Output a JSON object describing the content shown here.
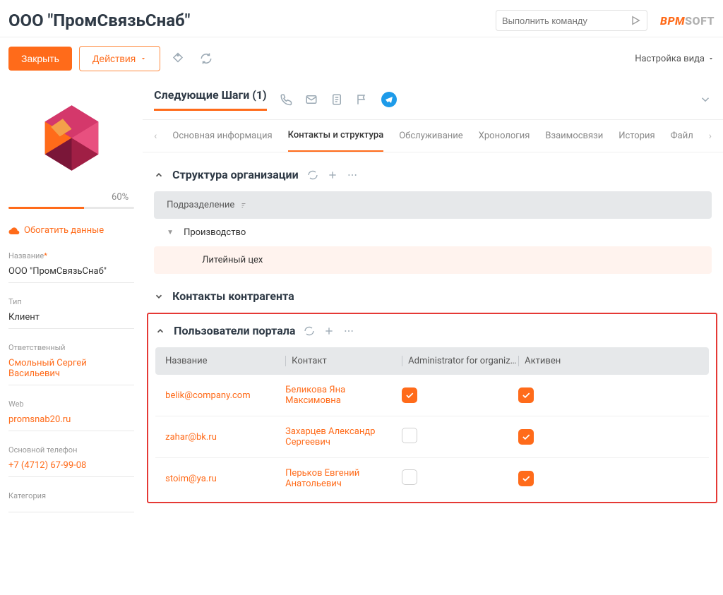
{
  "header": {
    "title": "ООО \"ПромСвязьСнаб\"",
    "command_placeholder": "Выполнить команду",
    "logo1": "BPM",
    "logo2": "SOFT"
  },
  "toolbar": {
    "close": "Закрыть",
    "actions": "Действия",
    "view": "Настройка вида"
  },
  "sidebar": {
    "progress_pct": "60%",
    "progress_fill": 60,
    "enrich": "Обогатить данные",
    "fields": {
      "name_label": "Название",
      "name_value": "ООО \"ПромСвязьСнаб\"",
      "type_label": "Тип",
      "type_value": "Клиент",
      "owner_label": "Ответственный",
      "owner_value": "Смольный Сергей Васильевич",
      "web_label": "Web",
      "web_value": "promsnab20.ru",
      "phone_label": "Основной телефон",
      "phone_value": "+7 (4712) 67-99-08",
      "category_label": "Категория"
    }
  },
  "steps": {
    "title": "Следующие Шаги (1)"
  },
  "tabs": [
    "Основная информация",
    "Контакты и структура",
    "Обслуживание",
    "Хронология",
    "Взаимосвязи",
    "История",
    "Файл"
  ],
  "active_tab": 1,
  "org": {
    "title": "Структура организации",
    "col": "Подразделение",
    "row1": "Производство",
    "row2": "Литейный цех"
  },
  "contacts": {
    "title": "Контакты контрагента"
  },
  "portal": {
    "title": "Пользователи портала",
    "cols": {
      "name": "Название",
      "contact": "Контакт",
      "admin": "Administrator for organiz…",
      "active": "Активен"
    },
    "rows": [
      {
        "name": "belik@company.com",
        "contact": "Беликова Яна Максимовна",
        "admin": true,
        "active": true
      },
      {
        "name": "zahar@bk.ru",
        "contact": "Захарцев Александр Сергеевич",
        "admin": false,
        "active": true
      },
      {
        "name": "stoim@ya.ru",
        "contact": "Перьков Евгений Анатольевич",
        "admin": false,
        "active": true
      }
    ]
  }
}
